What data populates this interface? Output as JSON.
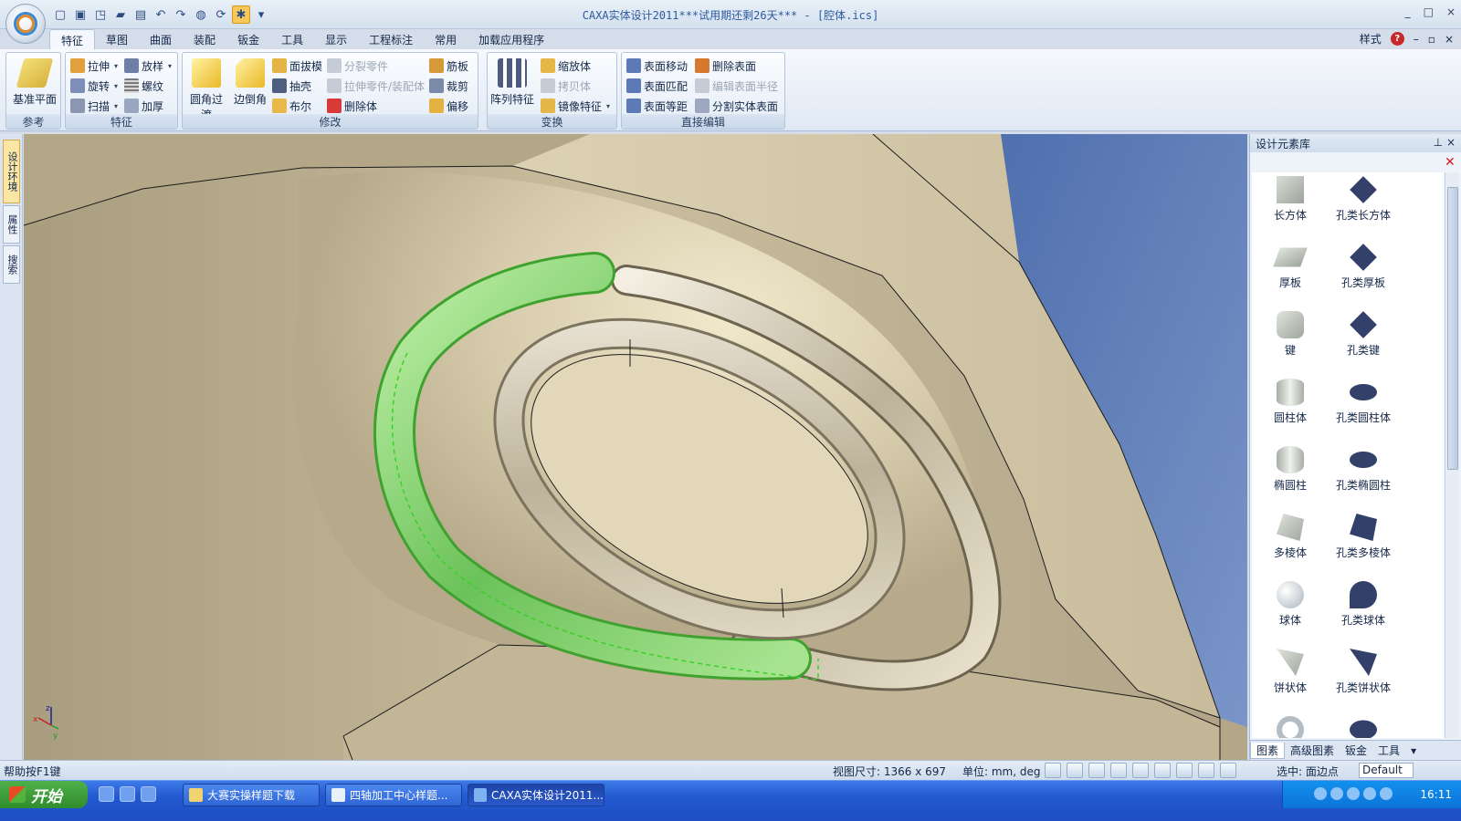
{
  "window": {
    "title": "CAXA实体设计2011***试用期还剩26天*** - [腔体.ics]",
    "controls": [
      "_",
      "□",
      "×"
    ]
  },
  "ribbon_tabs": [
    "特征",
    "草图",
    "曲面",
    "装配",
    "钣金",
    "工具",
    "显示",
    "工程标注",
    "常用",
    "加载应用程序"
  ],
  "ribbon_right": {
    "style_label": "样式",
    "help": "?"
  },
  "groups": {
    "reference": {
      "label": "参考",
      "big": "基准平面"
    },
    "feature": {
      "label": "特征",
      "items": [
        "拉伸",
        "放样",
        "旋转",
        "螺纹",
        "扫描",
        "加厚"
      ]
    },
    "modify": {
      "label": "修改",
      "big1": "圆角过渡",
      "big2": "边倒角",
      "items": [
        "面拔模",
        "分裂零件",
        "筋板",
        "抽壳",
        "拉伸零件/装配体",
        "裁剪",
        "布尔",
        "删除体",
        "偏移"
      ]
    },
    "transform": {
      "label": "变换",
      "big": "阵列特征",
      "items": [
        "缩放体",
        "拷贝体",
        "镜像特征"
      ]
    },
    "direct": {
      "label": "直接编辑",
      "items": [
        "表面移动",
        "删除表面",
        "表面匹配",
        "编辑表面半径",
        "表面等距",
        "分割实体表面"
      ]
    }
  },
  "left_tabs": [
    "设计环境",
    "属性",
    "搜索"
  ],
  "panel": {
    "title": "设计元素库",
    "items": [
      "长方体",
      "孔类长方体",
      "厚板",
      "孔类厚板",
      "键",
      "孔类键",
      "圆柱体",
      "孔类圆柱体",
      "椭圆柱",
      "孔类椭圆柱",
      "多棱体",
      "孔类多棱体",
      "球体",
      "孔类球体",
      "饼状体",
      "孔类饼状体"
    ],
    "tabs": [
      "图素",
      "高级图素",
      "钣金",
      "工具"
    ]
  },
  "statusbar": {
    "help": "帮助按F1键",
    "view_size": "视图尺寸: 1366 x  697",
    "units": "单位: mm, deg",
    "select": "选中: 面边点",
    "default": "Default"
  },
  "taskbar": {
    "start": "开始",
    "tasks": [
      "大赛实操样题下载",
      "四轴加工中心样题...",
      "CAXA实体设计2011..."
    ],
    "clock": "16:11"
  },
  "axes": {
    "x": "x",
    "y": "y",
    "z": "z"
  },
  "colors": {
    "selection": "#35d025",
    "background_sky": "#5c7bb5",
    "model_body": "#d8cdaa"
  }
}
